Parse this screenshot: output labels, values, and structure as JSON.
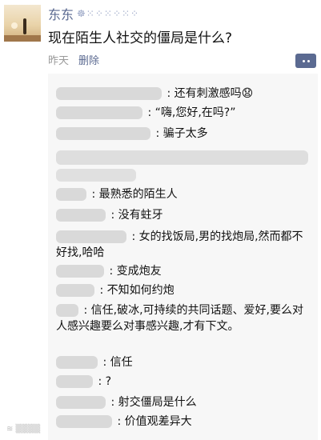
{
  "post": {
    "author": "东东",
    "author_suffix": "☸⁙⁘⁙⁘⁙⁘",
    "title": "现在陌生人社交的僵局是什么?",
    "time": "昨天",
    "delete": "删除"
  },
  "comments": [
    {
      "text": ": 还有刺激感吗😧"
    },
    {
      "text": ": “嗨,您好,在吗?”"
    },
    {
      "text": ": 骗子太多"
    },
    {
      "text": ": 最熟悉的陌生人"
    },
    {
      "text": ": 没有蛀牙"
    },
    {
      "text": ": 女的找饭局,男的找炮局,然而都不好找,哈哈"
    },
    {
      "text": ": 变成炮友"
    },
    {
      "text": ": 不知如何约炮"
    },
    {
      "text": ": 信任,破冰,可持续的共同话题、爱好,要么对人感兴趣要么对事感兴趣,才有下文。"
    },
    {
      "text": ": 信任"
    },
    {
      "text": ": ?"
    },
    {
      "text": ": 射交僵局是什么"
    },
    {
      "text": ": 价值观差异大"
    }
  ]
}
